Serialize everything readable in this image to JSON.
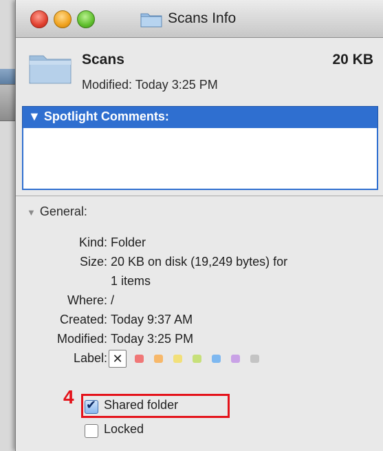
{
  "window": {
    "title": "Scans Info"
  },
  "file": {
    "name": "Scans",
    "size": "20 KB",
    "modified_line": "Modified: Today 3:25 PM",
    "icon": "folder-icon"
  },
  "spotlight": {
    "title": "Spotlight Comments:",
    "disclosure": "▼",
    "comment": ""
  },
  "general": {
    "title": "General:",
    "disclosure": "▼",
    "kind_label": "Kind:",
    "kind_value": "Folder",
    "size_label": "Size:",
    "size_value_line1": "20 KB on disk (19,249 bytes) for",
    "size_value_line2": "1 items",
    "where_label": "Where:",
    "where_value": "/",
    "created_label": "Created:",
    "created_value": "Today 9:37 AM",
    "modified_label": "Modified:",
    "modified_value": "Today 3:25 PM",
    "label_label": "Label:",
    "label_none": "✕",
    "label_colors": [
      "#f07777",
      "#f7b86a",
      "#f2e07a",
      "#c7e07a",
      "#7eb8f0",
      "#c9a2e6",
      "#c4c4c4"
    ]
  },
  "annotation": {
    "step_number": "4",
    "color": "#e4121a"
  },
  "checkboxes": {
    "shared_folder_label": "Shared folder",
    "shared_folder_checked": true,
    "locked_label": "Locked",
    "locked_checked": false,
    "checkmark": "✔"
  }
}
